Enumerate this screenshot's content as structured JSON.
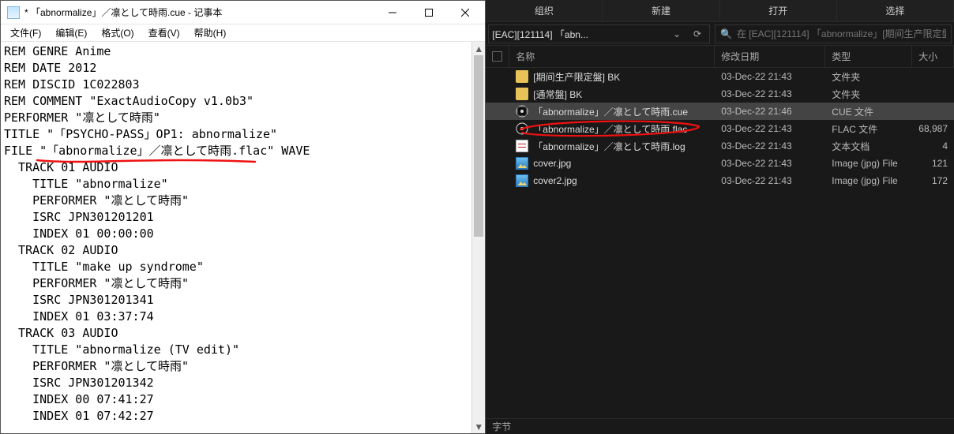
{
  "notepad": {
    "title": "* 「abnormalize」／凛として時雨.cue - 记事本",
    "menu": {
      "file": "文件(F)",
      "edit": "编辑(E)",
      "format": "格式(O)",
      "view": "查看(V)",
      "help": "帮助(H)"
    },
    "lines": [
      "REM GENRE Anime",
      "REM DATE 2012",
      "REM DISCID 1C022803",
      "REM COMMENT \"ExactAudioCopy v1.0b3\"",
      "PERFORMER \"凛として時雨\"",
      "TITLE \"「PSYCHO-PASS」OP1: abnormalize\"",
      "FILE \"「abnormalize」／凛として時雨.flac\" WAVE",
      "  TRACK 01 AUDIO",
      "    TITLE \"abnormalize\"",
      "    PERFORMER \"凛として時雨\"",
      "    ISRC JPN301201201",
      "    INDEX 01 00:00:00",
      "  TRACK 02 AUDIO",
      "    TITLE \"make up syndrome\"",
      "    PERFORMER \"凛として時雨\"",
      "    ISRC JPN301201341",
      "    INDEX 01 03:37:74",
      "  TRACK 03 AUDIO",
      "    TITLE \"abnormalize (TV edit)\"",
      "    PERFORMER \"凛として時雨\"",
      "    ISRC JPN301201342",
      "    INDEX 00 07:41:27",
      "    INDEX 01 07:42:27"
    ]
  },
  "explorer": {
    "ribbon": {
      "org": "组织",
      "new": "新建",
      "open": "打开",
      "select": "选择"
    },
    "address": "[EAC][121114] 「abn...",
    "search_placeholder": "在 [EAC][121114] 「abnormalize」[期间生产限定盤",
    "columns": {
      "name": "名称",
      "date": "修改日期",
      "type": "类型",
      "size": "大小"
    },
    "rows": [
      {
        "icon": "folder",
        "name": "[期间生产限定盤] BK",
        "date": "03-Dec-22 21:43",
        "type": "文件夹",
        "size": "",
        "checked": false
      },
      {
        "icon": "folder",
        "name": "[通常盤] BK",
        "date": "03-Dec-22 21:43",
        "type": "文件夹",
        "size": "",
        "checked": false
      },
      {
        "icon": "cue",
        "name": "「abnormalize」／凛として時雨.cue",
        "date": "03-Dec-22 21:46",
        "type": "CUE 文件",
        "size": "",
        "checked": true,
        "selected": true
      },
      {
        "icon": "flac",
        "name": "「abnormalize」／凛として時雨.flac",
        "date": "03-Dec-22 21:43",
        "type": "FLAC 文件",
        "size": "68,987",
        "checked": false,
        "annot": true
      },
      {
        "icon": "log",
        "name": "「abnormalize」／凛として時雨.log",
        "date": "03-Dec-22 21:43",
        "type": "文本文档",
        "size": "4",
        "checked": false
      },
      {
        "icon": "jpg",
        "name": "cover.jpg",
        "date": "03-Dec-22 21:43",
        "type": "Image (jpg) File",
        "size": "121",
        "checked": false
      },
      {
        "icon": "jpg",
        "name": "cover2.jpg",
        "date": "03-Dec-22 21:43",
        "type": "Image (jpg) File",
        "size": "172",
        "checked": false
      }
    ],
    "status": "字节"
  }
}
